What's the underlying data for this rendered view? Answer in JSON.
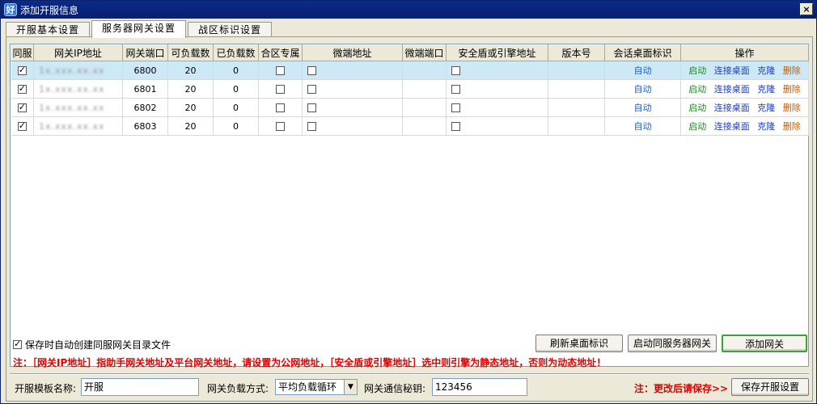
{
  "window": {
    "title": "添加开服信息",
    "icon_char": "好",
    "close": "×"
  },
  "tabs": [
    {
      "label": "开服基本设置"
    },
    {
      "label": "服务器网关设置"
    },
    {
      "label": "战区标识设置"
    }
  ],
  "table": {
    "headers": [
      "同服",
      "网关IP地址",
      "网关端口",
      "可负载数",
      "已负载数",
      "合区专属",
      "微端地址",
      "微端端口",
      "安全盾或引擎地址",
      "版本号",
      "会话桌面标识",
      "操作"
    ],
    "rows": [
      {
        "checked": true,
        "ip": "1x.xxx.xx.xx",
        "port": "6800",
        "capacity": "20",
        "loaded": "0",
        "desktop": "自动"
      },
      {
        "checked": true,
        "ip": "1x.xxx.xx.xx",
        "port": "6801",
        "capacity": "20",
        "loaded": "0",
        "desktop": "自动"
      },
      {
        "checked": true,
        "ip": "1x.xxx.xx.xx",
        "port": "6802",
        "capacity": "20",
        "loaded": "0",
        "desktop": "自动"
      },
      {
        "checked": true,
        "ip": "1x.xxx.xx.xx",
        "port": "6803",
        "capacity": "20",
        "loaded": "0",
        "desktop": "自动"
      }
    ],
    "actions": {
      "start": "启动",
      "connect": "连接桌面",
      "clone": "克隆",
      "delete": "删除"
    }
  },
  "options": {
    "auto_create_label": "保存时自动创建同服网关目录文件",
    "auto_create_checked": true
  },
  "buttons": {
    "refresh": "刷新桌面标识",
    "start_same": "启动同服务器网关",
    "add_gateway": "添加网关",
    "save": "保存开服设置"
  },
  "notice": "注：［网关IP地址］指助手网关地址及平台网关地址，请设置为公网地址，［安全盾或引擎地址］选中则引擎为静态地址，否则为动态地址！",
  "form": {
    "template_label": "开服模板名称:",
    "template_value": "开服",
    "load_mode_label": "网关负载方式:",
    "load_mode_value": "平均负载循环",
    "secret_label": "网关通信秘钥:",
    "secret_value": "123456",
    "save_hint": "注：更改后请保存>>"
  },
  "colors": {
    "title_bar": "#0b2a8a",
    "selected_row": "#cde8f6",
    "notice_red": "#e00000",
    "auto_link": "#1f5fbf"
  }
}
